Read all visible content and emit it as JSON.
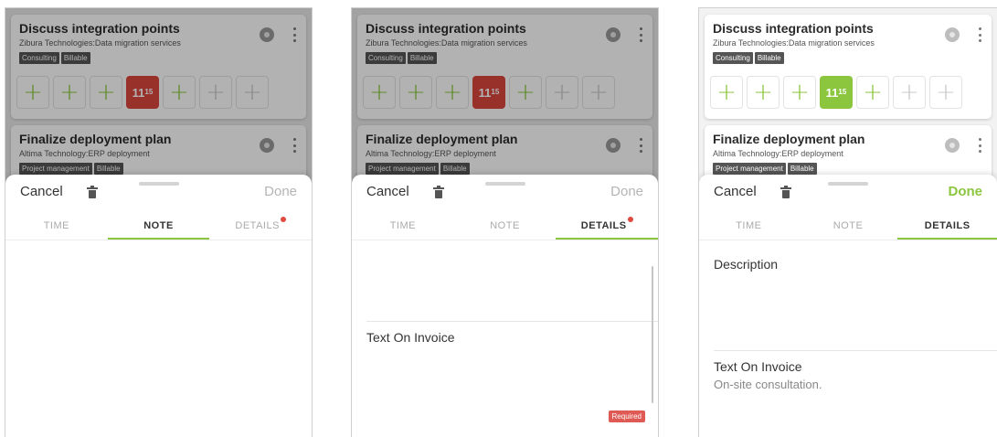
{
  "list": {
    "card1": {
      "title": "Discuss integration points",
      "subtitle": "Zibura Technologies:Data migration services",
      "tags": [
        "Consulting",
        "Billable"
      ],
      "day_cells": [
        {
          "kind": "plus-green",
          "text": "+"
        },
        {
          "kind": "plus-green",
          "text": "+"
        },
        {
          "kind": "plus-green",
          "text": "+"
        },
        {
          "kind": "time",
          "hours": "11",
          "minutes": "15"
        },
        {
          "kind": "plus-green",
          "text": "+"
        },
        {
          "kind": "plus-gray",
          "text": "+"
        },
        {
          "kind": "plus-gray",
          "text": "+"
        }
      ]
    },
    "card2": {
      "title": "Finalize deployment plan",
      "subtitle": "Altima Technology:ERP deployment",
      "tags": [
        "Project management",
        "Billable"
      ]
    }
  },
  "sheet": {
    "cancel_label": "Cancel",
    "done_label": "Done",
    "tabs": [
      "TIME",
      "NOTE",
      "DETAILS"
    ]
  },
  "screens": {
    "s2": {
      "text_on_invoice_label": "Text On Invoice",
      "required_badge": "Required"
    },
    "s3": {
      "description_label": "Description",
      "text_on_invoice_label": "Text On Invoice",
      "text_on_invoice_value": "On-site consultation."
    }
  },
  "colors": {
    "accent_green": "#8cc63e",
    "alert_red": "#d9473d",
    "tag_bg": "#555555"
  }
}
